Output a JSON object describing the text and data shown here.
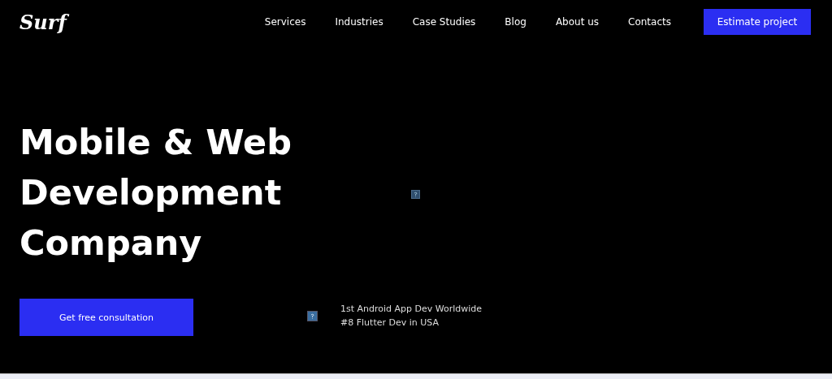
{
  "logo": "Surf",
  "nav": [
    {
      "label": "Services"
    },
    {
      "label": "Industries"
    },
    {
      "label": "Case Studies"
    },
    {
      "label": "Blog"
    },
    {
      "label": "About us"
    },
    {
      "label": "Contacts"
    }
  ],
  "cta": "Estimate project",
  "headline": [
    "Mobile & Web",
    "Development",
    "Company"
  ],
  "consult_button": "Get free consultation",
  "awards": [
    "1st Android App Dev Worldwide",
    "#8 Flutter Dev in USA"
  ]
}
